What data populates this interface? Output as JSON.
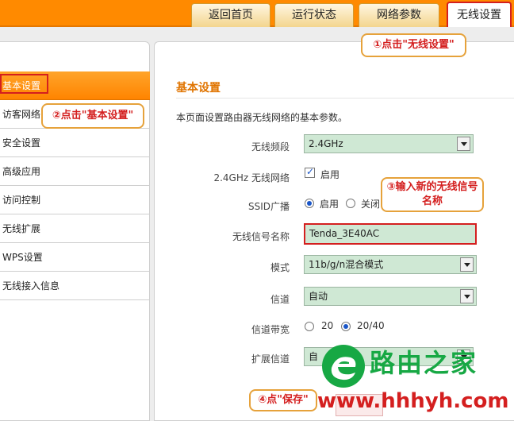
{
  "nav": {
    "tabs": [
      {
        "label": "返回首页"
      },
      {
        "label": "运行状态"
      },
      {
        "label": "网络参数"
      },
      {
        "label": "无线设置"
      }
    ]
  },
  "sidebar": {
    "items": [
      {
        "label": "基本设置"
      },
      {
        "label": "访客网络"
      },
      {
        "label": "安全设置"
      },
      {
        "label": "高级应用"
      },
      {
        "label": "访问控制"
      },
      {
        "label": "无线扩展"
      },
      {
        "label": "WPS设置"
      },
      {
        "label": "无线接入信息"
      }
    ]
  },
  "main": {
    "title": "基本设置",
    "description": "本页面设置路由器无线网络的基本参数。",
    "form": {
      "band_label": "无线频段",
      "band_value": "2.4GHz",
      "network_label": "2.4GHz 无线网络",
      "network_option": "启用",
      "ssid_broadcast_label": "SSID广播",
      "ssid_broadcast_on": "启用",
      "ssid_broadcast_off": "关闭",
      "ssid_name_label": "无线信号名称",
      "ssid_name_value": "Tenda_3E40AC",
      "mode_label": "模式",
      "mode_value": "11b/g/n混合模式",
      "channel_label": "信道",
      "channel_value": "自动",
      "bandwidth_label": "信道带宽",
      "bandwidth_20": "20",
      "bandwidth_2040": "20/40",
      "ext_channel_label": "扩展信道",
      "ext_channel_value": "自"
    }
  },
  "callouts": {
    "step1": "①点击\"无线设置\"",
    "step2": "②点击\"基本设置\"",
    "step3": "③输入新的无线信号名称",
    "step4": "④点\"保存\""
  },
  "watermark": {
    "title": "路由之家",
    "url": "www.hhhyh.com"
  },
  "colors": {
    "accent": "#ff8a00",
    "highlight": "#d41f1f",
    "field_bg": "#cfe8d4",
    "watermark_green": "#17a844"
  }
}
